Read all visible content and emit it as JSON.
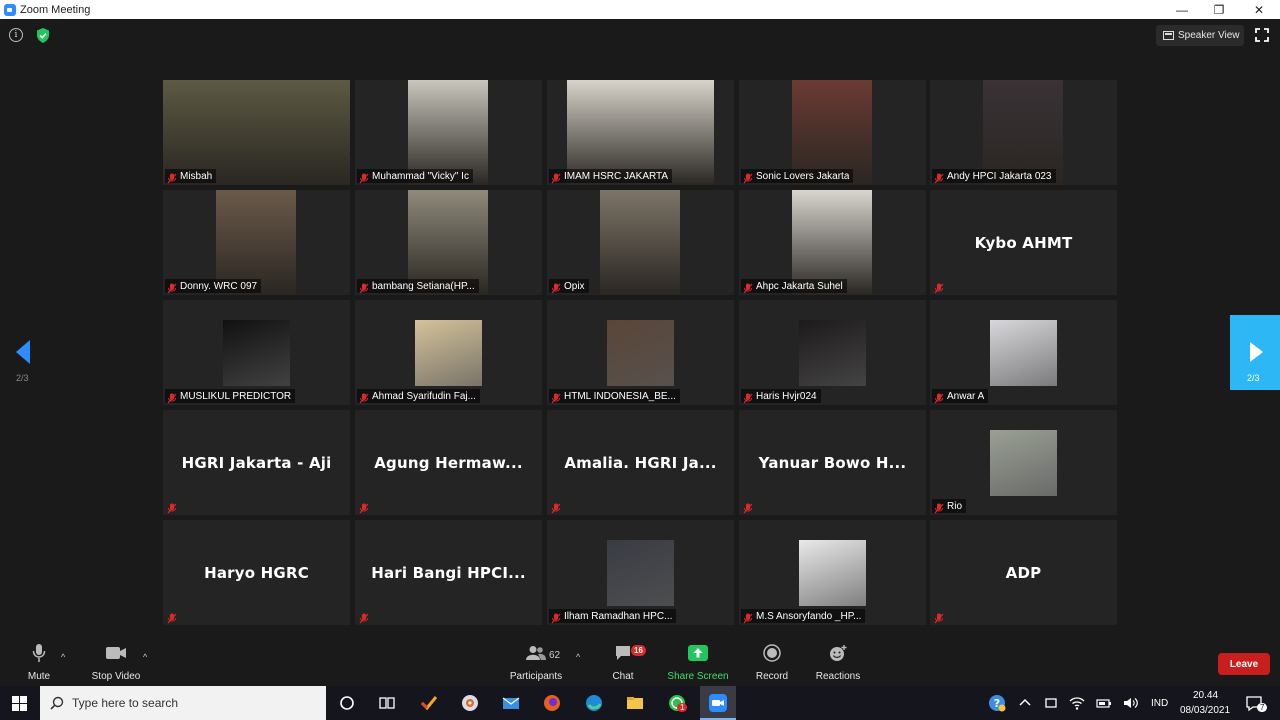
{
  "window": {
    "title": "Zoom Meeting",
    "minimize": "—",
    "maximize": "❐",
    "close": "✕"
  },
  "top": {
    "info_glyph": "i",
    "view_label": "Speaker View"
  },
  "paging": {
    "left": "2/3",
    "right": "2/3"
  },
  "tiles": [
    {
      "name": "Misbah",
      "type": "video",
      "bg": "#5c5a43"
    },
    {
      "name": "Muhammad \"Vicky\" Ic",
      "type": "video",
      "bg": "#c9c6bd"
    },
    {
      "name": "IMAM HSRC JAKARTA",
      "type": "video",
      "bg": "#d8d4cb"
    },
    {
      "name": "Sonic Lovers Jakarta",
      "type": "video",
      "bg": "#6a3b33"
    },
    {
      "name": "Andy HPCI Jakarta 023",
      "type": "video",
      "bg": "#3a3236"
    },
    {
      "name": "Donny. WRC 097",
      "type": "video",
      "bg": "#6b5a4a"
    },
    {
      "name": "bambang Setiana(HP...",
      "type": "video",
      "bg": "#8f8a7a"
    },
    {
      "name": "Opix",
      "type": "video",
      "bg": "#7d7568"
    },
    {
      "name": "Ahpc Jakarta Suhel",
      "type": "video",
      "bg": "#d9d6d0"
    },
    {
      "name": "",
      "big": "Kybo AHMT",
      "type": "name"
    },
    {
      "name": "MUSLIKUL PREDICTOR",
      "type": "thumb",
      "bg": "#111111"
    },
    {
      "name": "Ahmad Syarifudin Faj...",
      "type": "thumb",
      "bg": "#d4c29a"
    },
    {
      "name": "HTML INDONESIA_BE...",
      "type": "thumb",
      "bg": "#5a4638"
    },
    {
      "name": "Haris Hvjr024",
      "type": "thumb",
      "bg": "#1d1a1c"
    },
    {
      "name": "Anwar A",
      "type": "thumb",
      "bg": "#d8d8dc"
    },
    {
      "name": "",
      "big": "HGRI Jakarta - Aji",
      "type": "name"
    },
    {
      "name": "",
      "big": "Agung  Hermaw...",
      "type": "name"
    },
    {
      "name": "",
      "big": "Amalia.  HGRI  Ja...",
      "type": "name"
    },
    {
      "name": "",
      "big": "Yanuar Bowo H...",
      "type": "name"
    },
    {
      "name": "Rio",
      "type": "thumb",
      "bg": "#9aa095"
    },
    {
      "name": "",
      "big": "Haryo HGRC",
      "type": "name"
    },
    {
      "name": "",
      "big": "Hari Bangi HPCI...",
      "type": "name"
    },
    {
      "name": "Ilham Ramadhan HPC...",
      "type": "thumb",
      "bg": "#3a3c44"
    },
    {
      "name": "M.S Ansoryfando _HP...",
      "type": "thumb",
      "bg": "#e9e9ea"
    },
    {
      "name": "",
      "big": "ADP",
      "type": "name"
    }
  ],
  "toolbar": {
    "mute": "Mute",
    "stop_video": "Stop Video",
    "participants": "Participants",
    "participants_count": "62",
    "chat": "Chat",
    "chat_badge": "16",
    "share": "Share Screen",
    "record": "Record",
    "reactions": "Reactions",
    "leave": "Leave",
    "caret": "^"
  },
  "taskbar": {
    "search_placeholder": "Type here to search",
    "lang": "IND",
    "time": "20.44",
    "date": "08/03/2021",
    "whatsapp_badge": "1",
    "notif_count": "7"
  },
  "colors": {
    "accent": "#2d8cff",
    "share_green": "#22c55e",
    "leave_red": "#c81e1e",
    "mic_off_red": "#e02828"
  }
}
